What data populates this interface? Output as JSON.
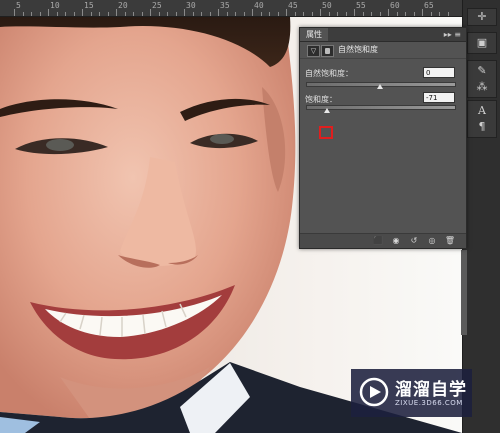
{
  "ruler": {
    "labels": [
      "5",
      "10",
      "15",
      "20",
      "25",
      "30",
      "35",
      "40",
      "45",
      "50",
      "55",
      "60",
      "65"
    ]
  },
  "panel": {
    "tab_label": "属性",
    "menu_icon": "panel-menu-icon",
    "adjustment_title": "自然饱和度",
    "vibrance": {
      "label": "自然饱和度：",
      "value": "0",
      "position": 0.5
    },
    "saturation": {
      "label": "饱和度：",
      "value": "-71",
      "position": 0.14
    }
  },
  "right_toolbar": {
    "icons": [
      "paragraph-mark-icon",
      "layers-icon",
      "brush-icon",
      "character-icon",
      "paragraph-icon"
    ]
  },
  "footer_icons": [
    "clip-to-layer-icon",
    "view-previous-icon",
    "reset-icon",
    "visibility-icon",
    "delete-icon"
  ],
  "watermark": {
    "title": "溜溜自学",
    "subtitle": "ZIXUE.3D66.COM"
  },
  "colors": {
    "panel": "#535353",
    "highlight": "#e01e1e",
    "logo_bg": "#1c203e"
  }
}
